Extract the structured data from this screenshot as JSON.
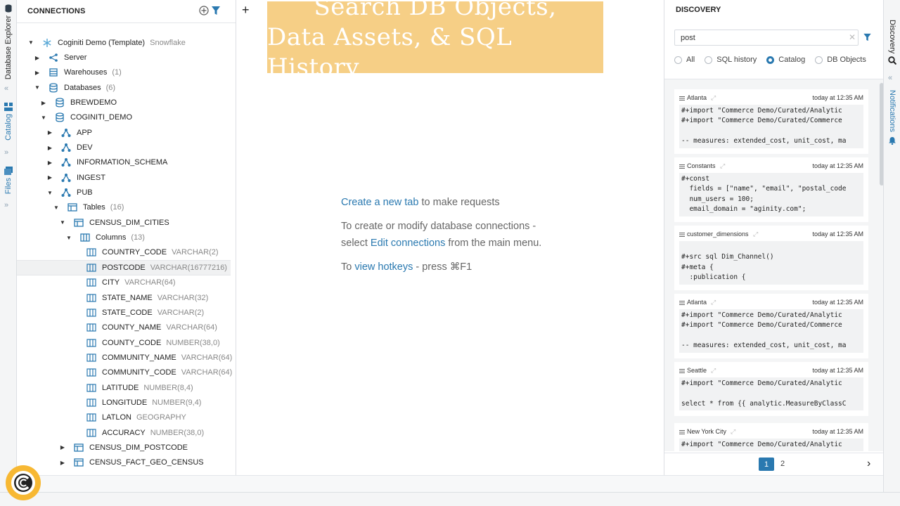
{
  "left_rail": {
    "database_explorer": "Database Explorer",
    "catalog": "Catalog",
    "files": "Files"
  },
  "connections": {
    "title": "CONNECTIONS",
    "tree": [
      {
        "label": "Coginiti Demo (Template)",
        "meta": "Snowflake",
        "icon": "snowflake-icon",
        "level": 0,
        "caret": "down"
      },
      {
        "label": "Server",
        "meta": "",
        "icon": "server-icon",
        "level": 1,
        "caret": "right"
      },
      {
        "label": "Warehouses",
        "meta": "(1)",
        "icon": "warehouse-icon",
        "level": 1,
        "caret": "right"
      },
      {
        "label": "Databases",
        "meta": "(6)",
        "icon": "database-icon",
        "level": 1,
        "caret": "down"
      },
      {
        "label": "BREWDEMO",
        "meta": "",
        "icon": "database-icon",
        "level": 2,
        "caret": "right"
      },
      {
        "label": "COGINITI_DEMO",
        "meta": "",
        "icon": "database-icon",
        "level": 2,
        "caret": "down"
      },
      {
        "label": "APP",
        "meta": "",
        "icon": "schema-icon",
        "level": 3,
        "caret": "right"
      },
      {
        "label": "DEV",
        "meta": "",
        "icon": "schema-icon",
        "level": 3,
        "caret": "right"
      },
      {
        "label": "INFORMATION_SCHEMA",
        "meta": "",
        "icon": "schema-icon",
        "level": 3,
        "caret": "right"
      },
      {
        "label": "INGEST",
        "meta": "",
        "icon": "schema-icon",
        "level": 3,
        "caret": "right"
      },
      {
        "label": "PUB",
        "meta": "",
        "icon": "schema-icon",
        "level": 3,
        "caret": "down"
      },
      {
        "label": "Tables",
        "meta": "(16)",
        "icon": "table-icon",
        "level": 4,
        "caret": "down"
      },
      {
        "label": "CENSUS_DIM_CITIES",
        "meta": "",
        "icon": "table-icon",
        "level": 5,
        "caret": "down"
      },
      {
        "label": "Columns",
        "meta": "(13)",
        "icon": "columns-icon",
        "level": 6,
        "caret": "down"
      },
      {
        "label": "COUNTRY_CODE",
        "meta": "VARCHAR(2)",
        "icon": "column-icon",
        "level": 7,
        "caret": ""
      },
      {
        "label": "POSTCODE",
        "meta": "VARCHAR(16777216)",
        "icon": "column-icon",
        "level": 7,
        "caret": "",
        "selected": true
      },
      {
        "label": "CITY",
        "meta": "VARCHAR(64)",
        "icon": "column-icon",
        "level": 7,
        "caret": ""
      },
      {
        "label": "STATE_NAME",
        "meta": "VARCHAR(32)",
        "icon": "column-icon",
        "level": 7,
        "caret": ""
      },
      {
        "label": "STATE_CODE",
        "meta": "VARCHAR(2)",
        "icon": "column-icon",
        "level": 7,
        "caret": ""
      },
      {
        "label": "COUNTY_NAME",
        "meta": "VARCHAR(64)",
        "icon": "column-icon",
        "level": 7,
        "caret": ""
      },
      {
        "label": "COUNTY_CODE",
        "meta": "NUMBER(38,0)",
        "icon": "column-icon",
        "level": 7,
        "caret": ""
      },
      {
        "label": "COMMUNITY_NAME",
        "meta": "VARCHAR(64)",
        "icon": "column-icon",
        "level": 7,
        "caret": ""
      },
      {
        "label": "COMMUNITY_CODE",
        "meta": "VARCHAR(64)",
        "icon": "column-icon",
        "level": 7,
        "caret": ""
      },
      {
        "label": "LATITUDE",
        "meta": "NUMBER(8,4)",
        "icon": "column-icon",
        "level": 7,
        "caret": ""
      },
      {
        "label": "LONGITUDE",
        "meta": "NUMBER(9,4)",
        "icon": "column-icon",
        "level": 7,
        "caret": ""
      },
      {
        "label": "LATLON",
        "meta": "GEOGRAPHY",
        "icon": "column-icon",
        "level": 7,
        "caret": ""
      },
      {
        "label": "ACCURACY",
        "meta": "NUMBER(38,0)",
        "icon": "column-icon",
        "level": 7,
        "caret": ""
      },
      {
        "label": "CENSUS_DIM_POSTCODE",
        "meta": "",
        "icon": "table-icon",
        "level": 5,
        "caret": "right"
      },
      {
        "label": "CENSUS_FACT_GEO_CENSUS",
        "meta": "",
        "icon": "table-icon",
        "level": 5,
        "caret": "right"
      }
    ]
  },
  "center": {
    "banner_line1": "Search DB Objects,",
    "banner_line2": "Data Assets, & SQL History",
    "create_link": "Create a new tab",
    "create_rest": " to make requests",
    "conn_line1": "To create or modify database connections -",
    "conn_select": "select ",
    "edit_link": "Edit connections",
    "conn_rest": " from the main menu.",
    "to": "To ",
    "hotkeys_link": "view hotkeys",
    "hotkeys_rest": " - press ⌘F1"
  },
  "discovery": {
    "title": "DISCOVERY",
    "search_value": "post",
    "filters": [
      {
        "label": "All",
        "checked": false
      },
      {
        "label": "SQL history",
        "checked": false
      },
      {
        "label": "Catalog",
        "checked": true
      },
      {
        "label": "DB Objects",
        "checked": false
      }
    ],
    "results": [
      {
        "name": "Atlanta",
        "time": "today at 12:35 AM",
        "code": "#+import \"Commerce Demo/Curated/Analytic\n#+import \"Commerce Demo/Curated/Commerce\n\n-- measures: extended_cost, unit_cost, ma"
      },
      {
        "name": "Constants",
        "time": "today at 12:35 AM",
        "code": "#+const\n  fields = [\"name\", \"email\", \"postal_code\n  num_users = 100;\n  email_domain = \"aginity.com\";"
      },
      {
        "name": "customer_dimensions",
        "time": "today at 12:35 AM",
        "code": "\n#+src sql Dim_Channel()\n#+meta {\n  :publication {"
      },
      {
        "name": "Atlanta",
        "time": "today at 12:35 AM",
        "code": "#+import \"Commerce Demo/Curated/Analytic\n#+import \"Commerce Demo/Curated/Commerce\n\n-- measures: extended_cost, unit_cost, ma"
      },
      {
        "name": "Seattle",
        "time": "today at 12:35 AM",
        "code": "#+import \"Commerce Demo/Curated/Analytic\n\nselect * from {{ analytic.MeasureByClassC"
      },
      {
        "name": "New York City",
        "time": "today at 12:35 AM",
        "code": "#+import \"Commerce Demo/Curated/Analytic\n"
      }
    ],
    "pages": [
      "1",
      "2"
    ]
  },
  "right_rail": {
    "discovery": "Discovery",
    "notifications": "Notifications"
  },
  "colors": {
    "accent": "#2a79b0",
    "banner": "#f6cf86",
    "logo": "#f7b833"
  }
}
